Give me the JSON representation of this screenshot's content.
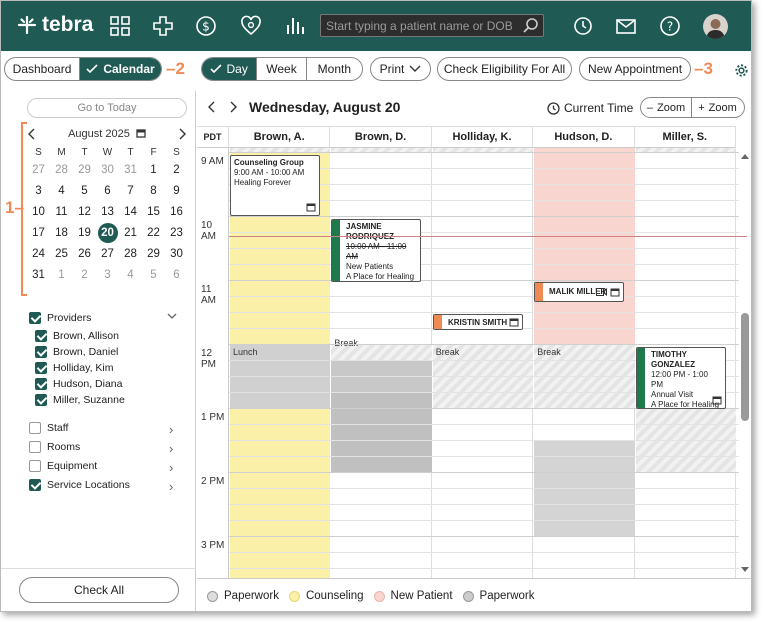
{
  "app": {
    "logo": "tebra",
    "search_placeholder": "Start typing a patient name or DOB"
  },
  "nav_icons": [
    "grid-icon",
    "plus-icon",
    "dollar-icon",
    "heart-icon",
    "chart-icon"
  ],
  "right_icons": [
    "history-icon",
    "mail-icon",
    "help-icon"
  ],
  "toolbar": {
    "dashboard": "Dashboard",
    "calendar": "Calendar",
    "day": "Day",
    "week": "Week",
    "month": "Month",
    "print": "Print",
    "eligibility": "Check Eligibility For All",
    "new_appt": "New Appointment",
    "anno2": "2",
    "anno3": "3"
  },
  "left": {
    "goto_today": "Go to Today",
    "month_title": "August 2025",
    "dow": [
      "S",
      "M",
      "T",
      "W",
      "T",
      "F",
      "S"
    ],
    "weeks": [
      [
        "27",
        "28",
        "29",
        "30",
        "31",
        "1",
        "2"
      ],
      [
        "3",
        "4",
        "5",
        "6",
        "7",
        "8",
        "9"
      ],
      [
        "10",
        "11",
        "12",
        "13",
        "14",
        "15",
        "16"
      ],
      [
        "17",
        "18",
        "19",
        "20",
        "21",
        "22",
        "23"
      ],
      [
        "24",
        "25",
        "26",
        "27",
        "28",
        "29",
        "30"
      ],
      [
        "31",
        "1",
        "2",
        "3",
        "4",
        "5",
        "6"
      ]
    ],
    "anno1": "1",
    "providers_label": "Providers",
    "providers": [
      "Brown, Allison",
      "Brown, Daniel",
      "Holliday, Kim",
      "Hudson, Diana",
      "Miller, Suzanne"
    ],
    "filters": [
      {
        "label": "Staff",
        "checked": false
      },
      {
        "label": "Rooms",
        "checked": false
      },
      {
        "label": "Equipment",
        "checked": false
      },
      {
        "label": "Service Locations",
        "checked": true
      }
    ],
    "check_all": "Check All"
  },
  "main": {
    "date_title": "Wednesday, August 20",
    "current_time": "Current Time",
    "zoom_out": "Zoom",
    "zoom_in": "Zoom",
    "tz": "PDT",
    "columns": [
      "Brown, A.",
      "Brown, D.",
      "Holliday, K.",
      "Hudson, D.",
      "Miller, S."
    ],
    "times": [
      "9 AM",
      "10 AM",
      "11 AM",
      "12 PM",
      "1 PM",
      "2 PM",
      "3 PM"
    ],
    "labels": {
      "lunch": "Lunch",
      "break": "Break"
    },
    "appointments": [
      {
        "title": "Counseling Group",
        "time": "9:00 AM - 10:00 AM",
        "place": "Healing Forever"
      },
      {
        "title": "JASMINE RODRIQUEZ",
        "time": "10:00 AM - 11:00 AM",
        "type": "New Patients",
        "place": "A Place for Healing"
      },
      {
        "title": "MALIK MILLER"
      },
      {
        "title": "KRISTIN SMITH"
      },
      {
        "title": "TIMOTHY GONZALEZ",
        "time": "12:00 PM - 1:00 PM",
        "type": "Annual Visit",
        "place": "A Place for Healing"
      }
    ]
  },
  "legend": [
    "Paperwork",
    "Counseling",
    "New Patient",
    "Paperwork"
  ],
  "colors": {
    "brand": "#1f5a54",
    "counseling": "#fbf0a8",
    "new_patient": "#f9d5cf",
    "accent": "#f08a55"
  }
}
